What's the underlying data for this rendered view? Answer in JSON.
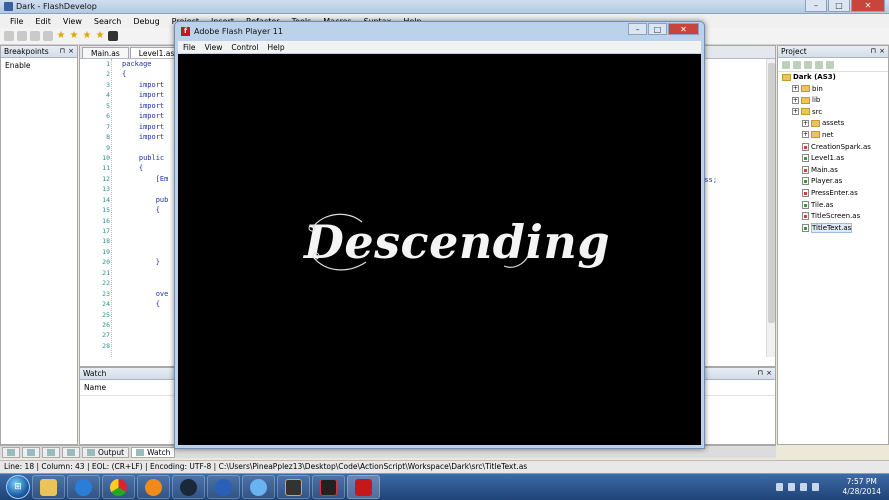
{
  "app": {
    "title": "Dark - FlashDevelop",
    "window_controls": {
      "minimize": "–",
      "maximize": "□",
      "close": "✕"
    }
  },
  "menu": [
    "File",
    "Edit",
    "View",
    "Search",
    "Debug",
    "Project",
    "Insert",
    "Refactor",
    "Tools",
    "Macros",
    "Syntax",
    "Help"
  ],
  "breakpoints": {
    "title": "Breakpoints",
    "pin": "⊓",
    "close": "×",
    "column": "Enable"
  },
  "editor": {
    "tabs": [
      "Main.as",
      "Level1.as"
    ],
    "line_numbers": [
      "1",
      "2",
      "3",
      "4",
      "5",
      "6",
      "7",
      "8",
      "9",
      "10",
      "11",
      "12",
      "13",
      "14",
      "15",
      "16",
      "17",
      "18",
      "19",
      "20",
      "21",
      "22",
      "23",
      "24",
      "25",
      "26",
      "27",
      "28"
    ],
    "code_lines": [
      "package",
      "{",
      "    import",
      "    import",
      "    import",
      "    import",
      "    import",
      "    import",
      "",
      "    public",
      "    {",
      "        [Em",
      "",
      "        pub",
      "        {",
      "",
      "",
      "",
      "",
      "        }",
      "",
      "",
      "        ove",
      "        {",
      "",
      "",
      "",
      ""
    ],
    "right_fragment": "lass;"
  },
  "watch": {
    "title": "Watch",
    "pin": "⊓",
    "close": "×",
    "column": "Name"
  },
  "project": {
    "title": "Project",
    "pin": "⊓",
    "close": "×",
    "root": "Dark (AS3)",
    "items": [
      {
        "label": "bin",
        "kind": "folder",
        "depth": 1
      },
      {
        "label": "lib",
        "kind": "folder",
        "depth": 1
      },
      {
        "label": "src",
        "kind": "folder",
        "depth": 1
      },
      {
        "label": "assets",
        "kind": "folder",
        "depth": 2
      },
      {
        "label": "net",
        "kind": "folder",
        "depth": 2
      },
      {
        "label": "CreationSpark.as",
        "kind": "file",
        "depth": 2
      },
      {
        "label": "Level1.as",
        "kind": "file",
        "depth": 2
      },
      {
        "label": "Main.as",
        "kind": "file",
        "depth": 2
      },
      {
        "label": "Player.as",
        "kind": "file",
        "depth": 2
      },
      {
        "label": "PressEnter.as",
        "kind": "file",
        "depth": 2
      },
      {
        "label": "Tile.as",
        "kind": "file",
        "depth": 2
      },
      {
        "label": "TitleScreen.as",
        "kind": "file",
        "depth": 2
      },
      {
        "label": "TitleText.as",
        "kind": "file",
        "depth": 2,
        "selected": true
      }
    ]
  },
  "bottom_tabs": [
    "Output",
    "Watch"
  ],
  "status": "Line: 18 | Column: 43 | EOL: (CR+LF) | Encoding: UTF-8 | C:\\Users\\PineaPplez13\\Desktop\\Code\\ActionScript\\Workspace\\Dark\\src\\TitleText.as",
  "flash_player": {
    "title": "Adobe Flash Player 11",
    "menu": [
      "File",
      "View",
      "Control",
      "Help"
    ],
    "stage_text": "Descending",
    "icon_letter": "f"
  },
  "taskbar": {
    "time": "7:57 PM",
    "date": "4/28/2014",
    "apps": [
      "windows-explorer",
      "media-player",
      "chrome",
      "blender",
      "steam",
      "chrome-app",
      "itunes",
      "flashdevelop",
      "effects",
      "adobe-flash"
    ]
  },
  "colors": {
    "editor_keyword": "#1a33a6",
    "line_number": "#2b8c8c",
    "taskbar": "#1f4378",
    "flash_stage": "#000000"
  }
}
